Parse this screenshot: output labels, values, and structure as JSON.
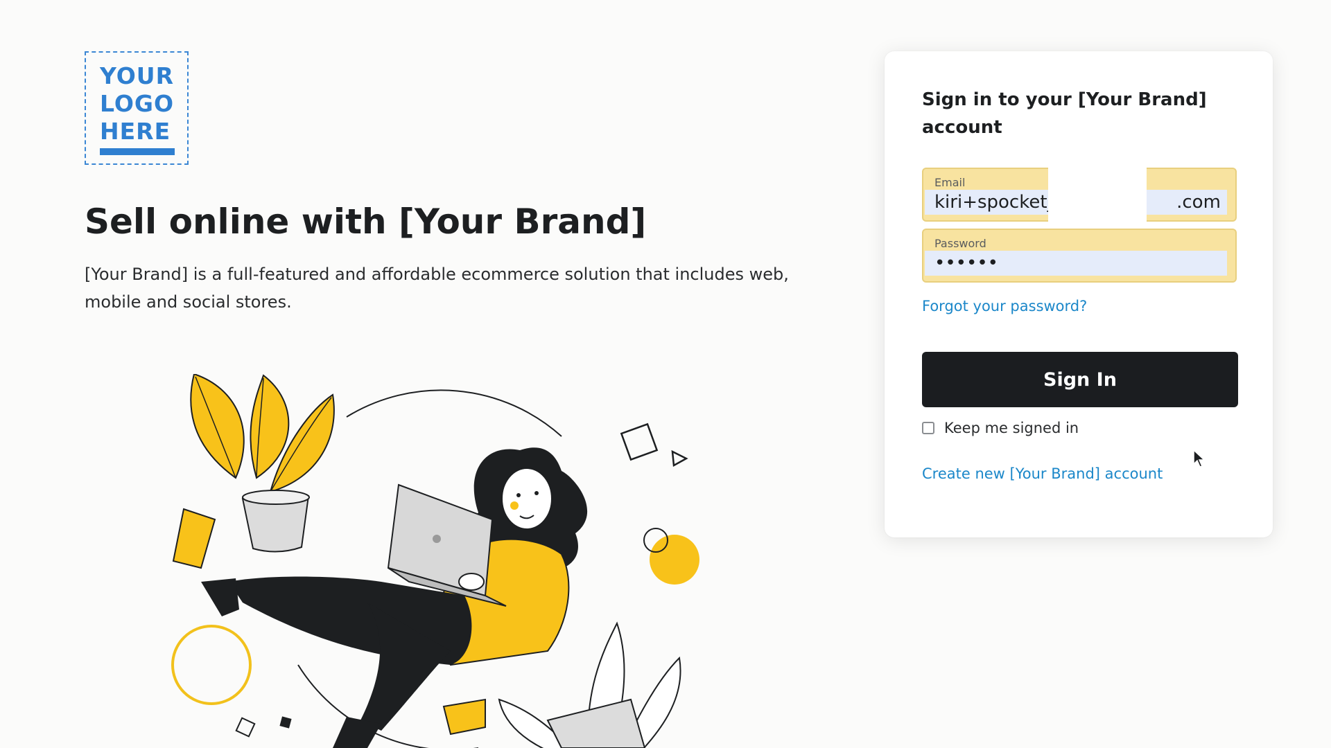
{
  "logo": {
    "lines": [
      "YOUR",
      "LOGO",
      "HERE"
    ]
  },
  "hero": {
    "title": "Sell online with [Your Brand]",
    "description": "[Your Brand] is a full-featured and affordable ecommerce solution that includes web, mobile and social stores."
  },
  "signin": {
    "title": "Sign in to your [Your Brand] account",
    "email": {
      "label": "Email",
      "value": "kiri+spocket_                     .com"
    },
    "password": {
      "label": "Password",
      "value": "••••••"
    },
    "forgot_link": "Forgot your password?",
    "submit_label": "Sign In",
    "keep_signed_in_label": "Keep me signed in",
    "create_link": "Create new [Your Brand] account"
  },
  "colors": {
    "brand_blue": "#2f7fd0",
    "link_blue": "#1b87c9",
    "button_dark": "#1b1d20",
    "autofill_yellow": "#f8e3a0",
    "illustration_yellow": "#f8c21a"
  },
  "illustration": {
    "icon": "woman-with-laptop-floating-illustration"
  }
}
